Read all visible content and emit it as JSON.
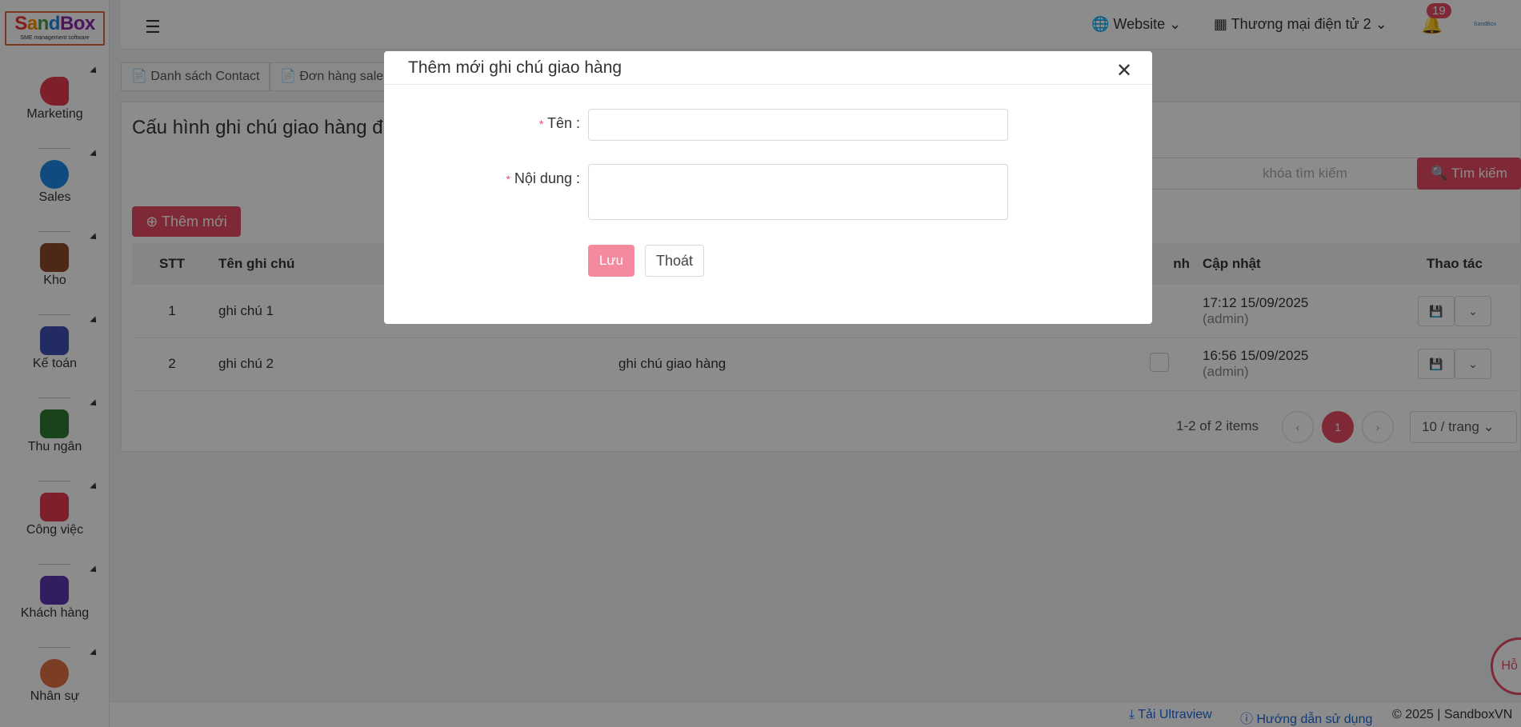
{
  "logo": {
    "b1": "S",
    "b2": "a",
    "b3": "n",
    "b4": "d",
    "b5": "Box",
    "tagline": "SME management software"
  },
  "sidebar": {
    "items": [
      {
        "label": "Marketing",
        "color": "#e53950"
      },
      {
        "label": "Sales",
        "color": "#1e88e5"
      },
      {
        "label": "Kho",
        "color": "#8d4a2a"
      },
      {
        "label": "Kế toán",
        "color": "#3f51b5"
      },
      {
        "label": "Thu ngân",
        "color": "#2e7d32"
      },
      {
        "label": "Công việc",
        "color": "#e53950"
      },
      {
        "label": "Khách hàng",
        "color": "#5e35b1"
      },
      {
        "label": "Nhân sự",
        "color": "#e07040"
      }
    ]
  },
  "header": {
    "website": "Website",
    "store": "Thương mại điện tử 2",
    "notification_count": "19",
    "avatar_text": "SandBox"
  },
  "tabs": [
    "Danh sách Contact",
    "Đơn hàng sale"
  ],
  "page": {
    "title": "Cấu hình ghi chú giao hàng đ",
    "search_placeholder": "khóa tìm kiếm",
    "search_button": "Tìm kiếm",
    "add_button": "Thêm mới"
  },
  "table": {
    "headers": [
      "STT",
      "Tên ghi chú",
      "",
      "nh",
      "Cập nhật",
      "Thao tác"
    ],
    "rows": [
      {
        "stt": "1",
        "name": "ghi chú 1",
        "content": "",
        "date": "17:12 15/09/2025",
        "user": "(admin)"
      },
      {
        "stt": "2",
        "name": "ghi chú 2",
        "content": "ghi chú giao hàng",
        "date": "16:56 15/09/2025",
        "user": "(admin)"
      }
    ]
  },
  "pagination": {
    "info": "1-2 of 2 items",
    "current": "1",
    "page_size": "10 / trang"
  },
  "footer": {
    "ultraview": "Tải Ultraview",
    "guide": "Hướng dẫn sử dụng",
    "copyright": "© 2025 | SandboxVN"
  },
  "support": "Hỗ trợ",
  "modal": {
    "title": "Thêm mới ghi chú giao hàng",
    "name_label": "Tên",
    "content_label": "Nội dung",
    "save_button": "Lưu",
    "cancel_button": "Thoát"
  },
  "colors": {
    "accent": "#e84c64",
    "link": "#1e6bd6"
  }
}
